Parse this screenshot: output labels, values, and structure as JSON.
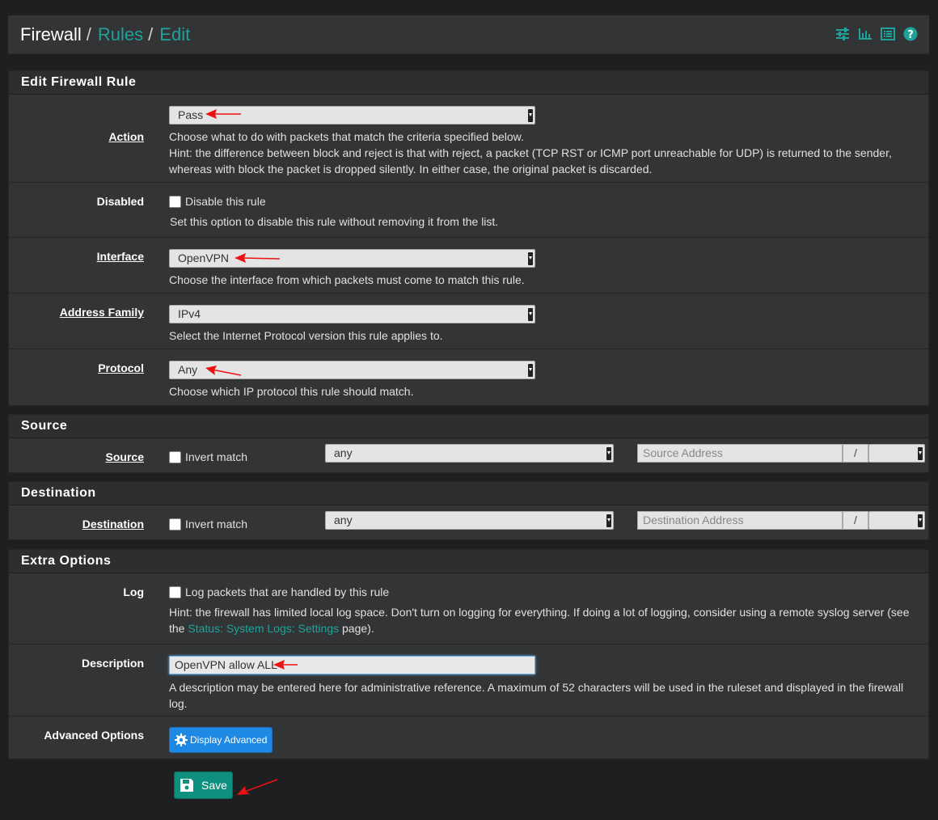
{
  "breadcrumb": {
    "root": "Firewall",
    "level1": "Rules",
    "level2": "Edit",
    "separator": "/"
  },
  "header_icons": [
    "sliders-icon",
    "chart-icon",
    "list-icon",
    "help-icon"
  ],
  "colors": {
    "accent": "#1fa29b",
    "save_button": "#0f8f7e",
    "advanced_button": "#1e88e5",
    "annotation_arrow": "#ee1111"
  },
  "edit_rule": {
    "title": "Edit Firewall Rule",
    "action": {
      "label": "Action",
      "value": "Pass",
      "help1": "Choose what to do with packets that match the criteria specified below.",
      "help2": "Hint: the difference between block and reject is that with reject, a packet (TCP RST or ICMP port unreachable for UDP) is returned to the sender,",
      "help3": "whereas with block the packet is dropped silently. In either case, the original packet is discarded."
    },
    "disabled": {
      "label": "Disabled",
      "checkbox": "Disable this rule",
      "help": "Set this option to disable this rule without removing it from the list."
    },
    "interface": {
      "label": "Interface",
      "value": "OpenVPN",
      "help": "Choose the interface from which packets must come to match this rule."
    },
    "address_family": {
      "label": "Address Family",
      "value": "IPv4",
      "help": "Select the Internet Protocol version this rule applies to."
    },
    "protocol": {
      "label": "Protocol",
      "value": "Any",
      "help": "Choose which IP protocol this rule should match."
    }
  },
  "source": {
    "title": "Source",
    "label": "Source",
    "invert": "Invert match",
    "type": "any",
    "address_placeholder": "Source Address",
    "slash": "/"
  },
  "destination": {
    "title": "Destination",
    "label": "Destination",
    "invert": "Invert match",
    "type": "any",
    "address_placeholder": "Destination Address",
    "slash": "/"
  },
  "extra": {
    "title": "Extra Options",
    "log": {
      "label": "Log",
      "checkbox": "Log packets that are handled by this rule",
      "help1": "Hint: the firewall has limited local log space. Don't turn on logging for everything. If doing a lot of logging, consider using a remote syslog server (see",
      "help2_pre": "the",
      "help2_link": "Status: System Logs: Settings",
      "help2_post": "page)."
    },
    "description": {
      "label": "Description",
      "value": "OpenVPN allow ALL",
      "help1": "A description may be entered here for administrative reference. A maximum of 52 characters will be used in the ruleset and displayed in the firewall",
      "help2": "log."
    },
    "advanced": {
      "label": "Advanced Options",
      "button": "Display Advanced"
    }
  },
  "save_button": "Save"
}
